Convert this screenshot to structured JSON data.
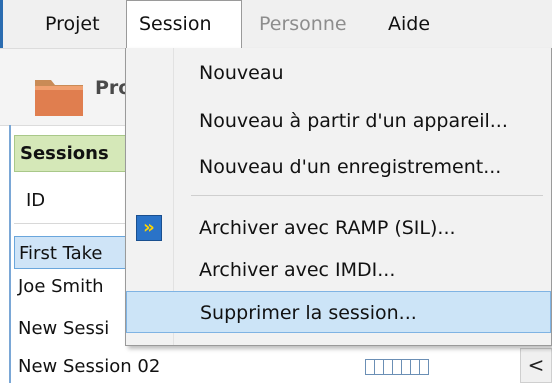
{
  "menubar": {
    "items": [
      {
        "label": "Projet",
        "state": "normal"
      },
      {
        "label": "Session",
        "state": "open"
      },
      {
        "label": "Personne",
        "state": "disabled"
      },
      {
        "label": "Aide",
        "state": "normal"
      }
    ]
  },
  "toolbar": {
    "project_label": "Pro"
  },
  "sessions_panel": {
    "header": "Sessions",
    "column_id": "ID",
    "rows": [
      "First Take",
      "Joe Smith",
      "New Sessi",
      "New Session 02"
    ]
  },
  "dropdown": {
    "items": [
      {
        "label": "Nouveau"
      },
      {
        "label": "Nouveau à partir d'un appareil..."
      },
      {
        "label": "Nouveau d'un enregistrement..."
      },
      {
        "label": "Archiver avec RAMP (SIL)...",
        "icon": "ramp-archive-icon"
      },
      {
        "label": "Archiver avec IMDI..."
      },
      {
        "label": "Supprimer la session...",
        "highlighted": true
      }
    ]
  },
  "colors": {
    "menu_highlight": "#cce4f7",
    "selection_border": "#6aa6dc",
    "sessions_header_bg": "#d5e8b8"
  },
  "icons": {
    "ramp": "»",
    "scroll_left": "<"
  }
}
